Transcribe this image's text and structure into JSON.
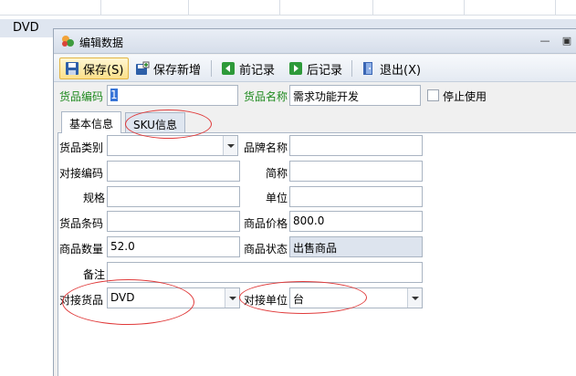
{
  "background": {
    "cell_text": "DVD"
  },
  "dialog": {
    "title": "编辑数据"
  },
  "toolbar": {
    "save": "保存(S)",
    "save_new": "保存新增",
    "prev": "前记录",
    "next": "后记录",
    "exit": "退出(X)"
  },
  "header": {
    "code_label": "货品编码",
    "code_value": "1",
    "name_label": "货品名称",
    "name_value": "需求功能开发",
    "disable_label": "停止使用"
  },
  "tabs": {
    "basic": "基本信息",
    "sku": "SKU信息"
  },
  "form": {
    "category_label": "货品类别",
    "category_value": "",
    "brand_label": "品牌名称",
    "brand_value": "",
    "dock_code_label": "对接编码",
    "dock_code_value": "",
    "short_label": "简称",
    "short_value": "",
    "spec_label": "规格",
    "spec_value": "",
    "unit_label": "单位",
    "unit_value": "",
    "barcode_label": "货品条码",
    "barcode_value": "",
    "price_label": "商品价格",
    "price_value": "800.0",
    "qty_label": "商品数量",
    "qty_value": "52.0",
    "status_label": "商品状态",
    "status_value": "出售商品",
    "remark_label": "备注",
    "remark_value": "",
    "dock_goods_label": "对接货品",
    "dock_goods_value": "DVD",
    "dock_unit_label": "对接单位",
    "dock_unit_value": "台"
  },
  "colors": {
    "accent_green": "#1f8a1f",
    "annotation_red": "#e03a3a",
    "selection_blue": "#3875d7"
  }
}
